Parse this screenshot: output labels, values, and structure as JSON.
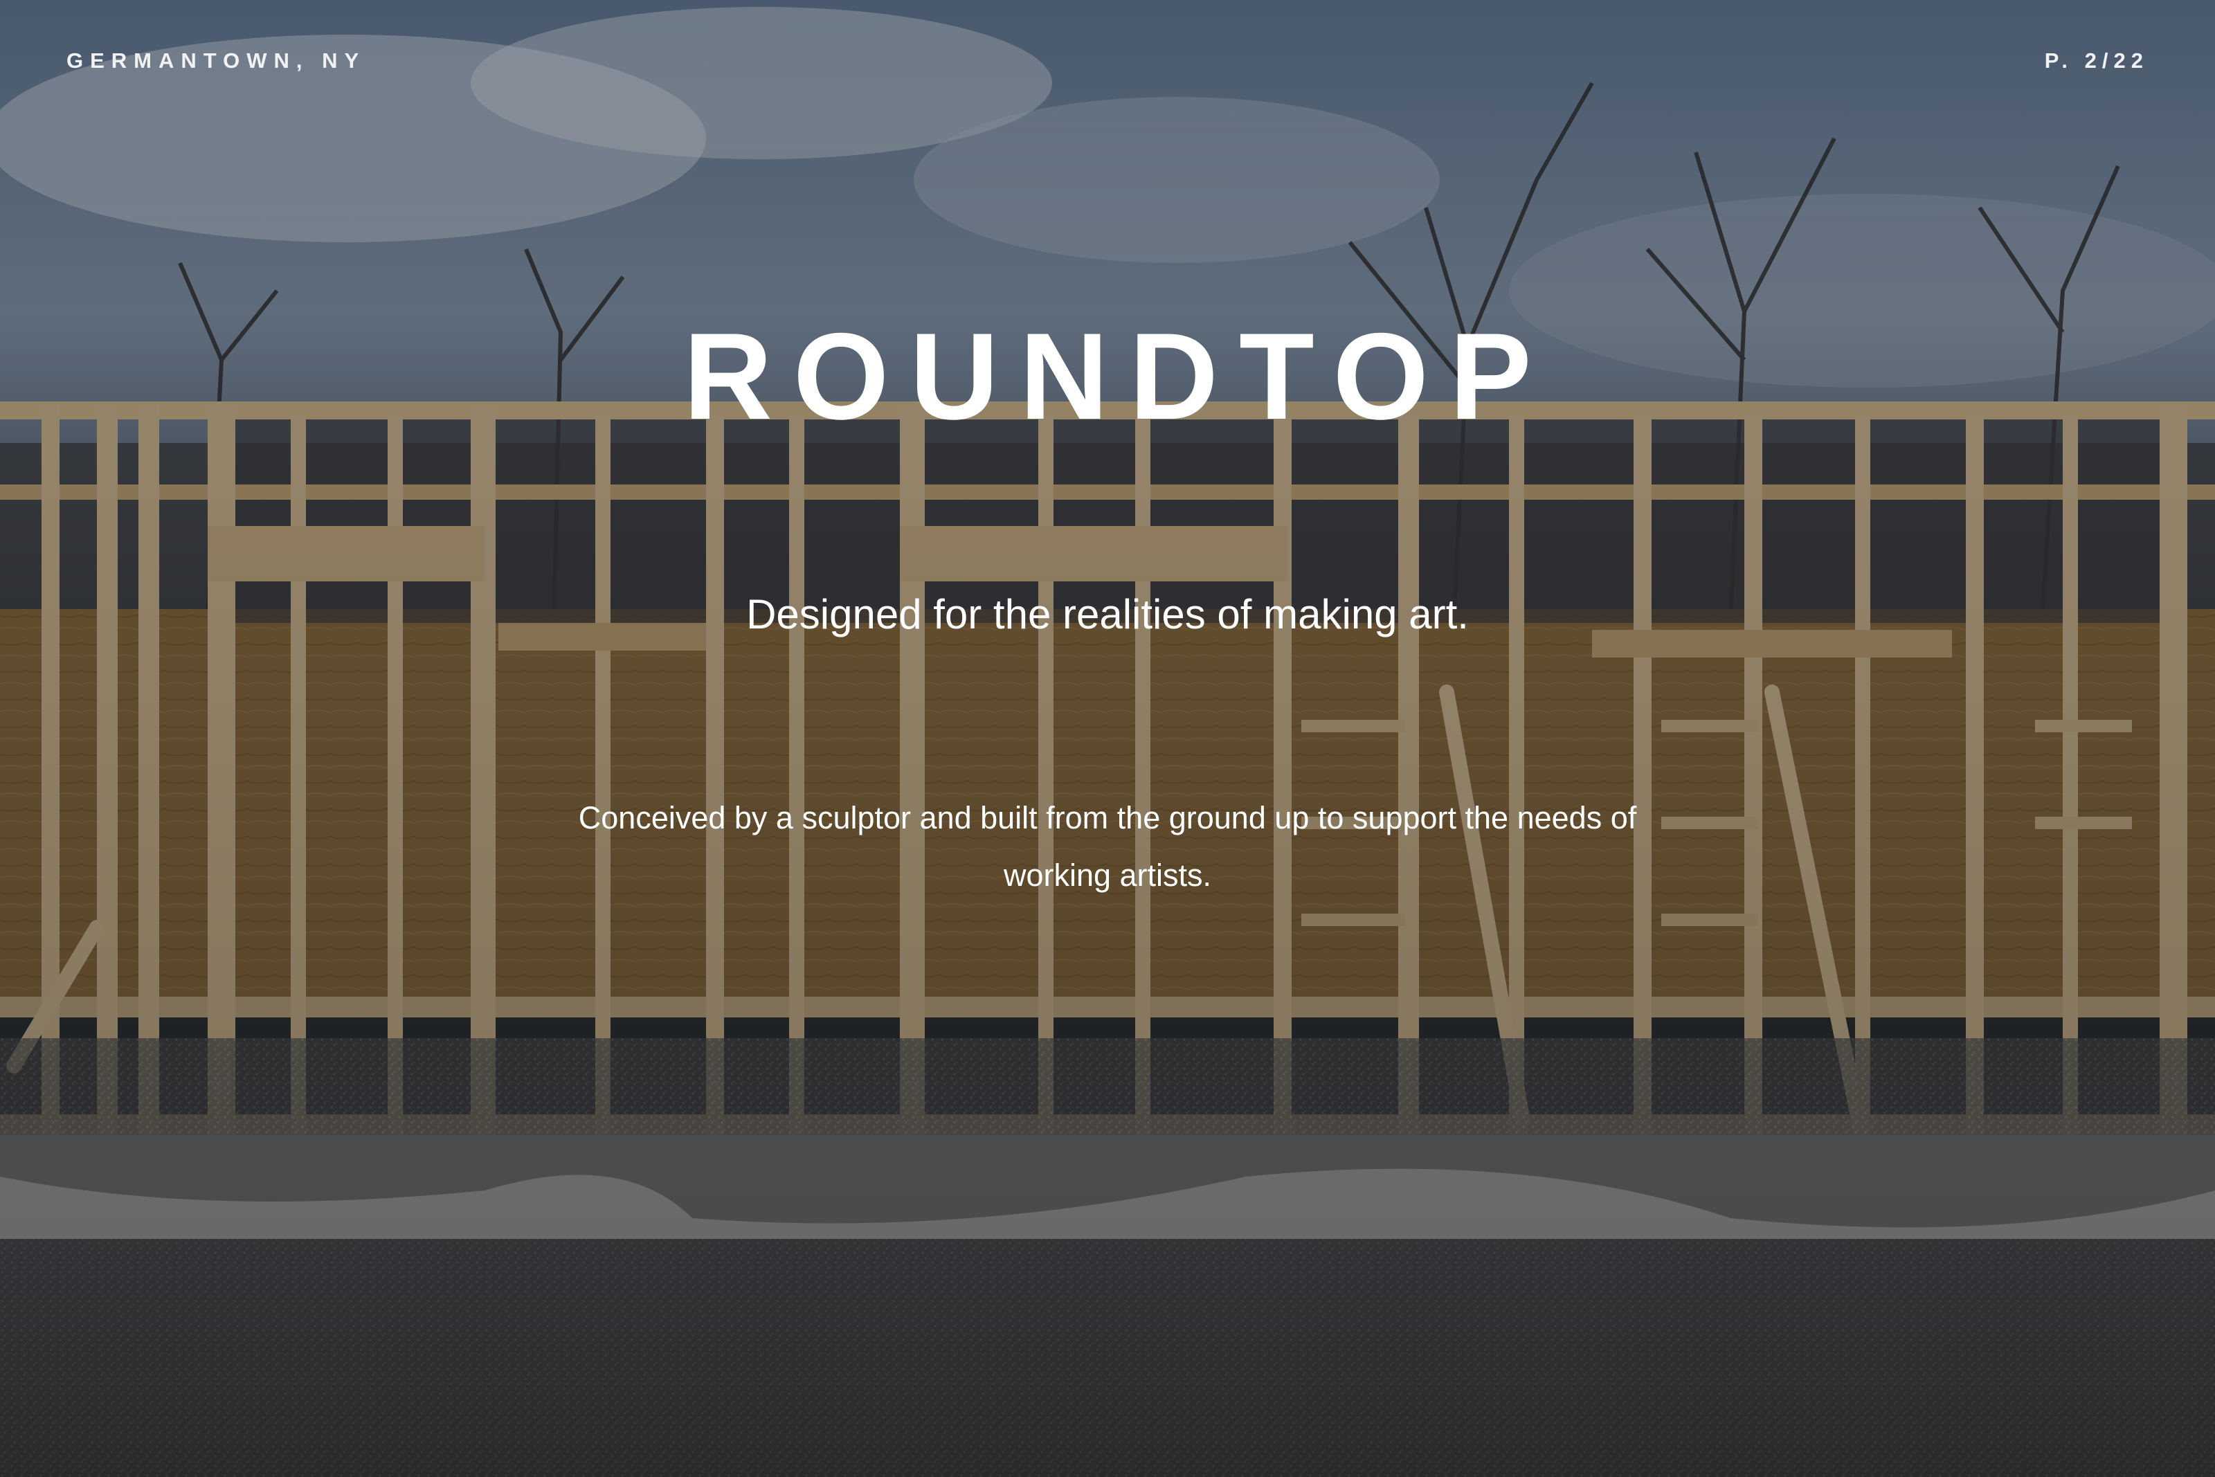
{
  "header": {
    "location": "GERMANTOWN, NY",
    "page_indicator": "P. 2/22"
  },
  "hero": {
    "title": "ROUNDTOP",
    "subtitle": "Designed for the realities of making art.",
    "description": "Conceived by a sculptor and built from the ground up to support the needs of working artists."
  },
  "colors": {
    "text": "#ffffff",
    "sky": "#6f8199",
    "wood": "#b8935f",
    "gravel": "#56575a"
  }
}
